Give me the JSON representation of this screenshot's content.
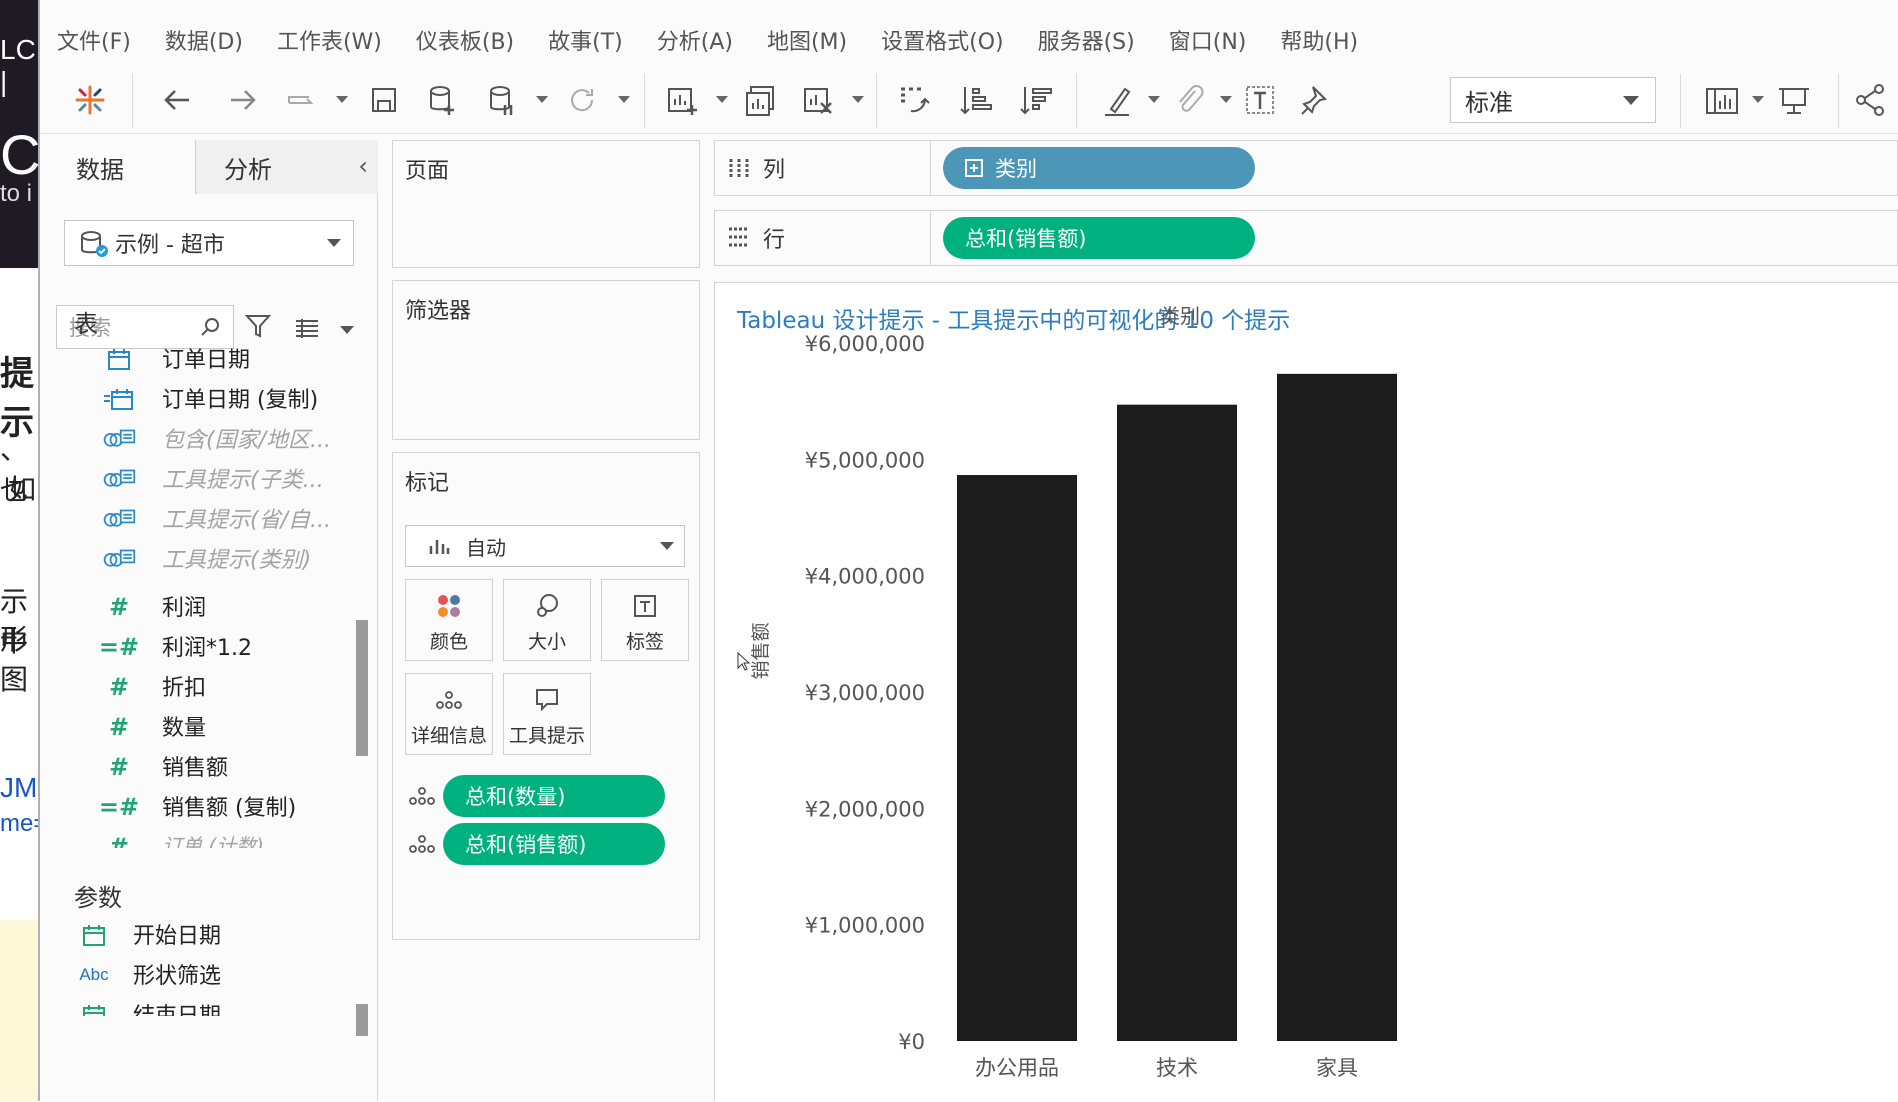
{
  "menu": [
    "文件(F)",
    "数据(D)",
    "工作表(W)",
    "仪表板(B)",
    "故事(T)",
    "分析(A)",
    "地图(M)",
    "设置格式(O)",
    "服务器(S)",
    "窗口(N)",
    "帮助(H)"
  ],
  "toolbar": {
    "fit_value": "标准"
  },
  "data_pane": {
    "tab_data": "数据",
    "tab_analysis": "分析",
    "datasource": "示例 - 超市",
    "search_placeholder": "搜索",
    "tables_header": "表",
    "fields": [
      {
        "name": "订单日期",
        "icon": "calendar-icon",
        "hidden": false
      },
      {
        "name": "订单日期 (复制)",
        "icon": "calendar-copy-icon",
        "hidden": false
      },
      {
        "name": "包含(国家/地区...",
        "icon": "set-icon",
        "hidden": true
      },
      {
        "name": "工具提示(子类...",
        "icon": "set-icon",
        "hidden": true
      },
      {
        "name": "工具提示(省/自...",
        "icon": "set-icon",
        "hidden": true
      },
      {
        "name": "工具提示(类别)",
        "icon": "set-icon",
        "hidden": true
      },
      {
        "name": "利润",
        "icon": "measure-icon",
        "hidden": false
      },
      {
        "name": "利润*1.2",
        "icon": "calc-measure-icon",
        "hidden": false
      },
      {
        "name": "折扣",
        "icon": "measure-icon",
        "hidden": false
      },
      {
        "name": "数量",
        "icon": "measure-icon",
        "hidden": false
      },
      {
        "name": "销售额",
        "icon": "measure-icon",
        "hidden": false
      },
      {
        "name": "销售额 (复制)",
        "icon": "calc-measure-icon",
        "hidden": false
      },
      {
        "name": "订单 (计数)",
        "icon": "measure-icon",
        "hidden": true
      }
    ],
    "params_header": "参数",
    "params": [
      {
        "name": "开始日期",
        "icon": "calendar-icon"
      },
      {
        "name": "形状筛选",
        "icon": "abc-icon"
      },
      {
        "name": "结束日期",
        "icon": "calendar-icon"
      }
    ]
  },
  "cards": {
    "pages": "页面",
    "filters": "筛选器",
    "marks": "标记",
    "mark_type": "自动",
    "mark_buttons": [
      "颜色",
      "大小",
      "标签",
      "详细信息",
      "工具提示"
    ],
    "mark_pills": [
      "总和(数量)",
      "总和(销售额)"
    ]
  },
  "shelves": {
    "columns_label": "列",
    "rows_label": "行",
    "columns_pill": "类别",
    "rows_pill": "总和(销售额)"
  },
  "view": {
    "title": "Tableau 设计提示 - 工具提示中的可视化的 10 个提示"
  },
  "chart_data": {
    "type": "bar",
    "title": "",
    "header": "类别",
    "categories": [
      "办公用品",
      "技术",
      "家具"
    ],
    "values": [
      4865000,
      5470000,
      5735000
    ],
    "ylabel": "销售额",
    "xlabel": "",
    "ylim": [
      0,
      6000000
    ],
    "yticks": [
      0,
      1000000,
      2000000,
      3000000,
      4000000,
      5000000,
      6000000
    ],
    "ytick_labels": [
      "¥0",
      "¥1,000,000",
      "¥2,000,000",
      "¥3,000,000",
      "¥4,000,000",
      "¥5,000,000",
      "¥6,000,000"
    ],
    "bar_color": "#1c1c1c",
    "grid": false
  },
  "colors": {
    "accent_green": "#00b180",
    "accent_blue": "#4c97b8",
    "title_blue": "#2c7cc1"
  },
  "bg": {
    "t1": "LC |",
    "t2": "Ci",
    "t3": "to i",
    "f1": "提示",
    "f2": "、也",
    "f3": "如",
    "f4": "示中",
    "f5": "形图",
    "f6": "JM",
    "f7": "me="
  }
}
